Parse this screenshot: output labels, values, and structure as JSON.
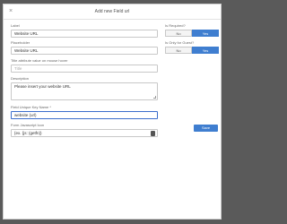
{
  "dialog": {
    "title": "Add new Field url",
    "close_symbol": "×"
  },
  "fields": {
    "label": {
      "label": "Label",
      "value": "Website URL"
    },
    "placeholder": {
      "label": "Placeholder",
      "value": "Website URL"
    },
    "tooltip": {
      "label": "Title attribute value on mouse hover",
      "placeholder": "Title"
    },
    "description": {
      "label": "Description",
      "value": "Please insert your website URL"
    },
    "unique_key": {
      "label": "Field Unique Key Name *",
      "value": "website (url)"
    },
    "expression": {
      "label": "Form Javascript Icon",
      "value": "{ex. {js: (getfn})"
    }
  },
  "toggles": {
    "required": {
      "label": "Is Required?",
      "no": "No",
      "yes": "Yes",
      "selected": "Yes"
    },
    "guest_only": {
      "label": "Is Only for Guest?",
      "no": "No",
      "yes": "Yes",
      "selected": "Yes"
    }
  },
  "actions": {
    "save_label": "Save"
  },
  "colors": {
    "primary": "#3f7ed0",
    "backdrop": "#5a5a5a"
  }
}
